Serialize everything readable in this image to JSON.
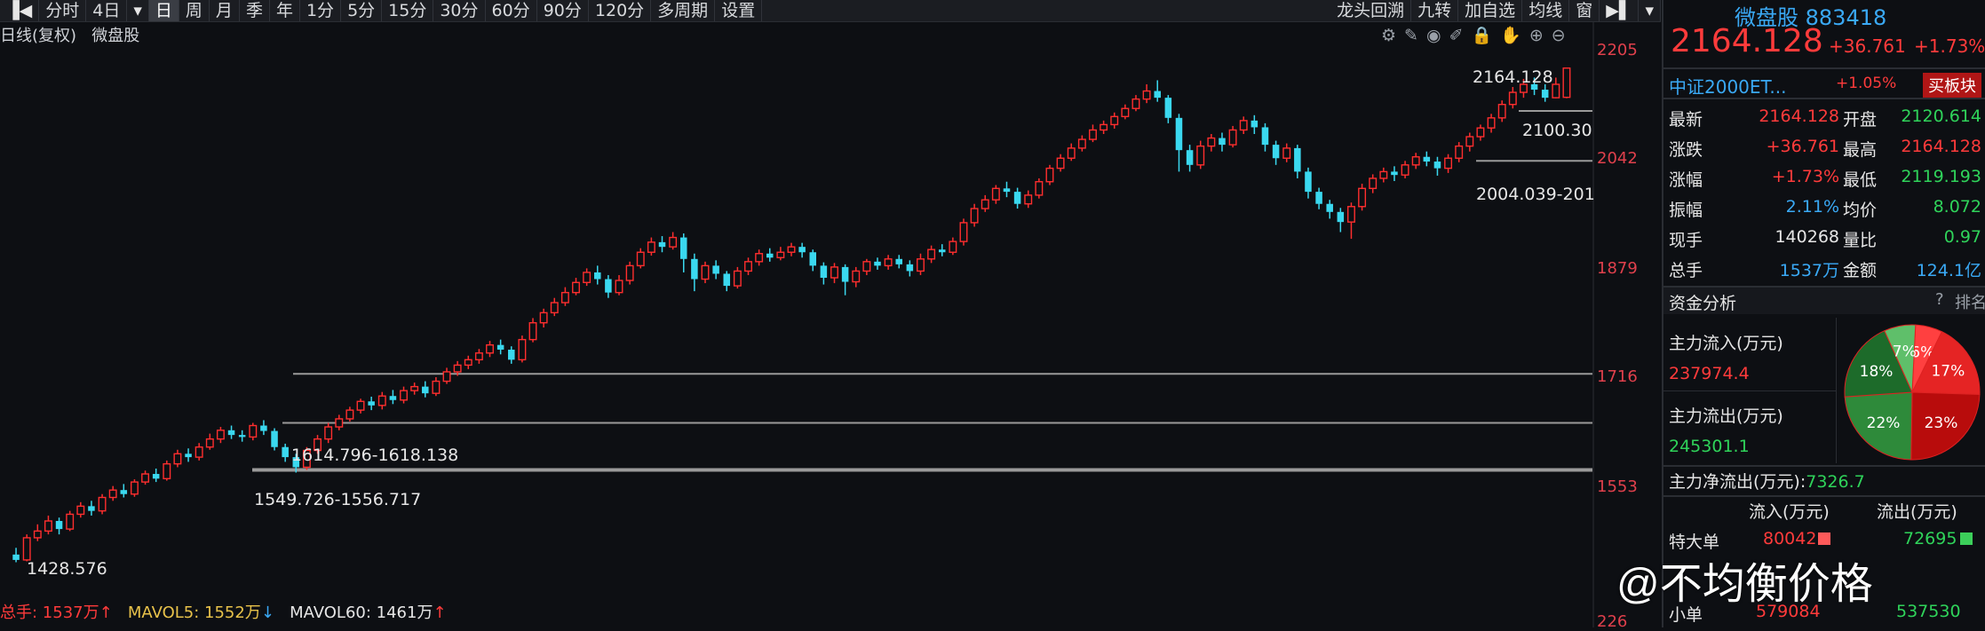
{
  "toolbar": {
    "items": [
      "分时",
      "4日",
      "日",
      "周",
      "月",
      "季",
      "年",
      "1分",
      "5分",
      "15分",
      "30分",
      "60分",
      "90分",
      "120分",
      "多周期",
      "设置"
    ],
    "active": "日",
    "right_items": [
      "龙头回溯",
      "九转",
      "加自选",
      "均线",
      "窗"
    ]
  },
  "chart": {
    "mode_label": "日线(复权)",
    "stock_label": "微盘股",
    "y_ticks": [
      "2205",
      "2042",
      "1879",
      "1716",
      "1553",
      "226"
    ],
    "annotations": {
      "high": "2164.128",
      "low": "1428.576",
      "level_2100": "2100.30",
      "range_2004": "2004.039-201",
      "range_1614": "1614.796-1618.138",
      "range_1549": "1549.726-1556.717"
    },
    "colors": {
      "up": "#ff2e2e",
      "down": "#3ad8ef",
      "hline": "#9a9a9a"
    }
  },
  "chart_data": {
    "type": "candlestick",
    "title": "",
    "candles": [
      [
        1440,
        1432,
        1450,
        1428.576
      ],
      [
        1432,
        1465,
        1470,
        1430
      ],
      [
        1465,
        1475,
        1485,
        1460
      ],
      [
        1475,
        1490,
        1498,
        1470
      ],
      [
        1490,
        1478,
        1495,
        1470
      ],
      [
        1478,
        1500,
        1505,
        1475
      ],
      [
        1500,
        1512,
        1518,
        1495
      ],
      [
        1512,
        1505,
        1520,
        1498
      ],
      [
        1505,
        1525,
        1530,
        1500
      ],
      [
        1525,
        1536,
        1542,
        1520
      ],
      [
        1536,
        1530,
        1545,
        1525
      ],
      [
        1530,
        1548,
        1552,
        1526
      ],
      [
        1548,
        1560,
        1565,
        1544
      ],
      [
        1560,
        1553,
        1568,
        1548
      ],
      [
        1553,
        1575,
        1580,
        1550
      ],
      [
        1575,
        1590,
        1596,
        1570
      ],
      [
        1590,
        1585,
        1598,
        1578
      ],
      [
        1585,
        1600,
        1606,
        1580
      ],
      [
        1600,
        1612,
        1620,
        1596
      ],
      [
        1612,
        1625,
        1630,
        1606
      ],
      [
        1625,
        1618,
        1632,
        1612
      ],
      [
        1618,
        1615,
        1625,
        1608
      ],
      [
        1615,
        1632,
        1636,
        1610
      ],
      [
        1632,
        1624,
        1640,
        1618
      ],
      [
        1624,
        1600,
        1628,
        1595
      ],
      [
        1600,
        1585,
        1605,
        1578
      ],
      [
        1585,
        1570,
        1590,
        1562
      ],
      [
        1570,
        1595,
        1600,
        1566
      ],
      [
        1595,
        1612,
        1618,
        1590
      ],
      [
        1612,
        1630,
        1636,
        1606
      ],
      [
        1630,
        1642,
        1648,
        1625
      ],
      [
        1642,
        1655,
        1660,
        1638
      ],
      [
        1655,
        1668,
        1672,
        1650
      ],
      [
        1668,
        1662,
        1675,
        1655
      ],
      [
        1662,
        1676,
        1682,
        1656
      ],
      [
        1676,
        1670,
        1685,
        1664
      ],
      [
        1670,
        1684,
        1690,
        1665
      ],
      [
        1684,
        1690,
        1696,
        1678
      ],
      [
        1690,
        1680,
        1698,
        1674
      ],
      [
        1680,
        1698,
        1704,
        1676
      ],
      [
        1698,
        1712,
        1718,
        1694
      ],
      [
        1712,
        1722,
        1728,
        1706
      ],
      [
        1722,
        1730,
        1736,
        1716
      ],
      [
        1730,
        1740,
        1746,
        1724
      ],
      [
        1740,
        1752,
        1758,
        1734
      ],
      [
        1752,
        1745,
        1760,
        1738
      ],
      [
        1745,
        1730,
        1750,
        1724
      ],
      [
        1730,
        1760,
        1766,
        1726
      ],
      [
        1760,
        1785,
        1792,
        1756
      ],
      [
        1785,
        1800,
        1806,
        1778
      ],
      [
        1800,
        1815,
        1822,
        1795
      ],
      [
        1815,
        1830,
        1838,
        1810
      ],
      [
        1830,
        1845,
        1852,
        1826
      ],
      [
        1845,
        1860,
        1866,
        1840
      ],
      [
        1860,
        1850,
        1870,
        1842
      ],
      [
        1850,
        1830,
        1856,
        1822
      ],
      [
        1830,
        1848,
        1856,
        1826
      ],
      [
        1848,
        1870,
        1876,
        1842
      ],
      [
        1870,
        1890,
        1896,
        1866
      ],
      [
        1890,
        1905,
        1912,
        1885
      ],
      [
        1905,
        1898,
        1914,
        1890
      ],
      [
        1898,
        1912,
        1920,
        1894
      ],
      [
        1912,
        1880,
        1918,
        1860
      ],
      [
        1880,
        1850,
        1888,
        1832
      ],
      [
        1850,
        1870,
        1876,
        1844
      ],
      [
        1870,
        1858,
        1878,
        1850
      ],
      [
        1858,
        1840,
        1862,
        1832
      ],
      [
        1840,
        1862,
        1868,
        1836
      ],
      [
        1862,
        1876,
        1882,
        1856
      ],
      [
        1876,
        1888,
        1894,
        1870
      ],
      [
        1888,
        1882,
        1896,
        1876
      ],
      [
        1882,
        1890,
        1898,
        1878
      ],
      [
        1890,
        1898,
        1904,
        1884
      ],
      [
        1898,
        1890,
        1904,
        1882
      ],
      [
        1890,
        1870,
        1894,
        1862
      ],
      [
        1870,
        1852,
        1875,
        1842
      ],
      [
        1852,
        1868,
        1874,
        1844
      ],
      [
        1868,
        1846,
        1872,
        1826
      ],
      [
        1846,
        1862,
        1868,
        1838
      ],
      [
        1862,
        1876,
        1880,
        1856
      ],
      [
        1876,
        1870,
        1882,
        1864
      ],
      [
        1870,
        1880,
        1886,
        1864
      ],
      [
        1880,
        1872,
        1886,
        1866
      ],
      [
        1872,
        1862,
        1878,
        1854
      ],
      [
        1862,
        1880,
        1888,
        1856
      ],
      [
        1880,
        1894,
        1900,
        1874
      ],
      [
        1894,
        1890,
        1902,
        1884
      ],
      [
        1890,
        1906,
        1912,
        1886
      ],
      [
        1906,
        1934,
        1940,
        1900
      ],
      [
        1934,
        1955,
        1962,
        1928
      ],
      [
        1955,
        1968,
        1975,
        1950
      ],
      [
        1968,
        1985,
        1990,
        1962
      ],
      [
        1985,
        1980,
        1995,
        1972
      ],
      [
        1980,
        1962,
        1986,
        1955
      ],
      [
        1962,
        1975,
        1982,
        1956
      ],
      [
        1975,
        1995,
        2000,
        1970
      ],
      [
        1995,
        2015,
        2020,
        1990
      ],
      [
        2015,
        2030,
        2036,
        2010
      ],
      [
        2030,
        2045,
        2052,
        2026
      ],
      [
        2045,
        2058,
        2064,
        2040
      ],
      [
        2058,
        2072,
        2080,
        2054
      ],
      [
        2072,
        2080,
        2086,
        2066
      ],
      [
        2080,
        2092,
        2098,
        2074
      ],
      [
        2092,
        2104,
        2110,
        2088
      ],
      [
        2104,
        2118,
        2124,
        2100
      ],
      [
        2118,
        2130,
        2140,
        2112
      ],
      [
        2130,
        2120,
        2146,
        2114
      ],
      [
        2120,
        2090,
        2124,
        2082
      ],
      [
        2090,
        2042,
        2096,
        2010
      ],
      [
        2042,
        2020,
        2050,
        2010
      ],
      [
        2020,
        2048,
        2056,
        2014
      ],
      [
        2048,
        2060,
        2066,
        2040
      ],
      [
        2060,
        2050,
        2068,
        2040
      ],
      [
        2050,
        2072,
        2078,
        2046
      ],
      [
        2072,
        2086,
        2092,
        2066
      ],
      [
        2086,
        2076,
        2094,
        2066
      ],
      [
        2076,
        2050,
        2082,
        2040
      ],
      [
        2050,
        2030,
        2056,
        2020
      ],
      [
        2030,
        2045,
        2052,
        2024
      ],
      [
        2045,
        2010,
        2050,
        2000
      ],
      [
        2010,
        1980,
        2016,
        1970
      ],
      [
        1980,
        1962,
        1986,
        1954
      ],
      [
        1962,
        1950,
        1968,
        1940
      ],
      [
        1950,
        1935,
        1956,
        1920
      ],
      [
        1935,
        1958,
        1964,
        1910
      ],
      [
        1958,
        1985,
        1992,
        1952
      ],
      [
        1985,
        2000,
        2006,
        1978
      ],
      [
        2000,
        2010,
        2016,
        1994
      ],
      [
        2010,
        2005,
        2018,
        1996
      ],
      [
        2005,
        2020,
        2026,
        2000
      ],
      [
        2020,
        2032,
        2038,
        2014
      ],
      [
        2032,
        2025,
        2040,
        2018
      ],
      [
        2025,
        2015,
        2032,
        2004
      ],
      [
        2015,
        2030,
        2036,
        2008
      ],
      [
        2030,
        2048,
        2054,
        2024
      ],
      [
        2048,
        2062,
        2068,
        2040
      ],
      [
        2062,
        2075,
        2080,
        2056
      ],
      [
        2075,
        2090,
        2096,
        2068
      ],
      [
        2090,
        2110,
        2116,
        2084
      ],
      [
        2110,
        2128,
        2136,
        2104
      ],
      [
        2128,
        2140,
        2148,
        2120
      ],
      [
        2140,
        2132,
        2150,
        2124
      ],
      [
        2132,
        2120,
        2140,
        2114
      ],
      [
        2120,
        2140,
        2150,
        2119.193
      ],
      [
        2120.614,
        2164.128,
        2164.128,
        2119.193
      ]
    ],
    "ylim": [
      1420,
      2210
    ],
    "grid": false
  },
  "volume": {
    "label": "总手: 1537万",
    "mavol5": "MAVOL5: 1552万",
    "mavol60": "MAVOL60: 1461万"
  },
  "panel": {
    "name": "微盘股",
    "code": "883418",
    "price": "2164.128",
    "change": "+36.761",
    "change_pct": "+1.73%",
    "etf_name": "中证2000ET...",
    "etf_pct": "+1.05%",
    "buy_block_btn": "买板块",
    "quotes": [
      {
        "l1": "最新",
        "v1": "2164.128",
        "c1": "red",
        "l2": "开盘",
        "v2": "2120.614",
        "c2": "green"
      },
      {
        "l1": "涨跌",
        "v1": "+36.761",
        "c1": "red",
        "l2": "最高",
        "v2": "2164.128",
        "c2": "red"
      },
      {
        "l1": "涨幅",
        "v1": "+1.73%",
        "c1": "red",
        "l2": "最低",
        "v2": "2119.193",
        "c2": "green"
      },
      {
        "l1": "振幅",
        "v1": "2.11%",
        "c1": "blue",
        "l2": "均价",
        "v2": "8.072",
        "c2": "green"
      },
      {
        "l1": "现手",
        "v1": "140268",
        "c1": "white",
        "l2": "量比",
        "v2": "0.97",
        "c2": "green"
      },
      {
        "l1": "总手",
        "v1": "1537万",
        "c1": "blue",
        "l2": "金额",
        "v2": "124.1亿",
        "c2": "blue"
      }
    ],
    "fund_title": "资金分析",
    "fund_help": "?",
    "fund_rank": "排名",
    "inflow_label": "主力流入(万元)",
    "inflow_value": "237974.4",
    "outflow_label": "主力流出(万元)",
    "outflow_value": "245301.1",
    "net_label": "主力净流出(万元):",
    "net_value": "7326.7",
    "pie": [
      {
        "pct": "6%",
        "value": 6,
        "color": "#ff4040"
      },
      {
        "pct": "17%",
        "value": 17,
        "color": "#e52424"
      },
      {
        "pct": "23%",
        "value": 23,
        "color": "#b80c0c"
      },
      {
        "pct": "22%",
        "value": 22,
        "color": "#2e8a3a"
      },
      {
        "pct": "18%",
        "value": 18,
        "color": "#1d6b2a"
      },
      {
        "pct": "7%",
        "value": 7,
        "color": "#5fbf6a"
      }
    ],
    "table_headers": [
      "流入(万元)",
      "流出(万元)"
    ],
    "table_rows": [
      {
        "label": "特大单",
        "in": "80042",
        "out": "72695"
      },
      {
        "label": "小单",
        "in": "579084",
        "out": "537530"
      }
    ]
  },
  "watermark": "@不均衡价格"
}
